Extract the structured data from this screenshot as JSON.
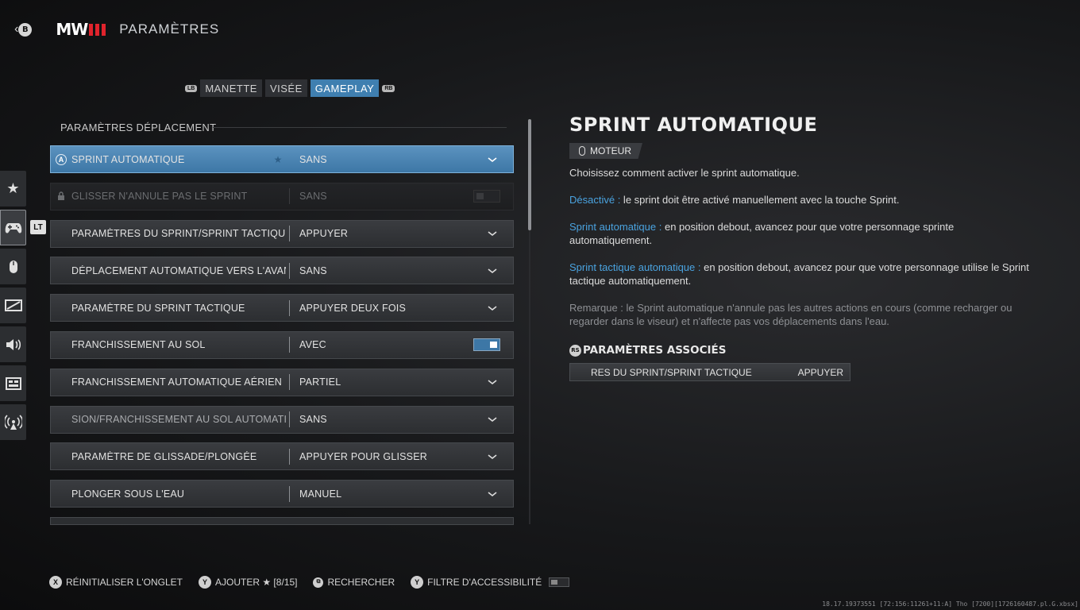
{
  "header": {
    "back_button": "B",
    "logo_text": "MW",
    "title": "PARAMÈTRES"
  },
  "tabs": {
    "left_bumper": "LB",
    "right_bumper": "RB",
    "items": [
      {
        "label": "MANETTE"
      },
      {
        "label": "VISÉE"
      },
      {
        "label": "GAMEPLAY"
      }
    ]
  },
  "section": {
    "title": "PARAMÈTRES DÉPLACEMENT"
  },
  "settings": [
    {
      "label": "SPRINT AUTOMATIQUE",
      "value": "SANS"
    },
    {
      "label": "GLISSER N'ANNULE PAS LE SPRINT",
      "value": "SANS"
    },
    {
      "label": "PARAMÈTRES DU SPRINT/SPRINT TACTIQUE",
      "value": "APPUYER"
    },
    {
      "label": "DÉPLACEMENT AUTOMATIQUE VERS L'AVANT",
      "value": "SANS"
    },
    {
      "label": "PARAMÈTRE DU SPRINT TACTIQUE",
      "value": "APPUYER DEUX FOIS"
    },
    {
      "label": "FRANCHISSEMENT AU SOL",
      "value": "AVEC"
    },
    {
      "label": "FRANCHISSEMENT AUTOMATIQUE AÉRIEN",
      "value": "PARTIEL"
    },
    {
      "label": "SION/FRANCHISSEMENT AU SOL AUTOMATIQUE",
      "value": "SANS"
    },
    {
      "label": "PARAMÈTRE DE GLISSADE/PLONGÉE",
      "value": "APPUYER POUR GLISSER"
    },
    {
      "label": "PLONGER SOUS L'EAU",
      "value": "MANUEL"
    }
  ],
  "selected_badge": "A",
  "rail_badge": "LT",
  "detail": {
    "title": "SPRINT AUTOMATIQUE",
    "tag": "MOTEUR",
    "intro": "Choisissez comment activer le sprint automatique.",
    "opt1_name": "Désactivé :",
    "opt1_text": " le sprint doit être activé manuellement avec la touche Sprint.",
    "opt2_name": "Sprint automatique :",
    "opt2_text": " en position debout, avancez pour que votre personnage sprinte automatiquement.",
    "opt3_name": "Sprint tactique automatique :",
    "opt3_text": " en position debout, avancez pour que votre personnage utilise le Sprint tactique automatiquement.",
    "note": "Remarque : le Sprint automatique n'annule pas les autres actions en cours (comme recharger ou regarder dans le viseur) et n'affecte pas vos déplacements dans l'eau.",
    "assoc_glyph": "RS",
    "assoc_title": "PARAMÈTRES ASSOCIÉS",
    "assoc_label": "RES DU SPRINT/SPRINT TACTIQUE",
    "assoc_value": "APPUYER"
  },
  "footer": {
    "reset_glyph": "X",
    "reset": "RÉINITIALISER L'ONGLET",
    "add_glyph": "Y",
    "add": "AJOUTER ★ [8/15]",
    "search_glyph": "⧉",
    "search": "RECHERCHER",
    "filter_glyph": "Y",
    "filter": "FILTRE D'ACCESSIBILITÉ"
  },
  "build": "18.17.19373551 [72:156:11261+11:A] Tho [7200][1726160487.pl.G.xbsx]"
}
